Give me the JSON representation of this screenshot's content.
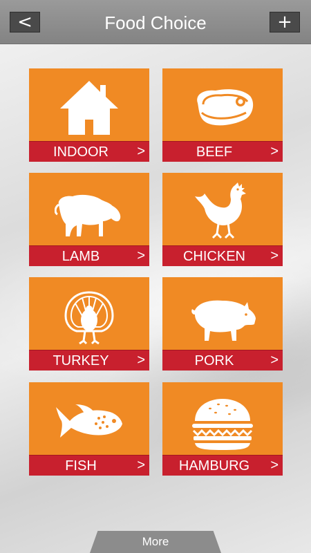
{
  "header": {
    "title": "Food Choice",
    "back_label": "<",
    "add_label": "+"
  },
  "tiles": [
    {
      "label": "INDOOR",
      "arrow": ">",
      "icon": "house-icon"
    },
    {
      "label": "BEEF",
      "arrow": ">",
      "icon": "steak-icon"
    },
    {
      "label": "LAMB",
      "arrow": ">",
      "icon": "lamb-icon"
    },
    {
      "label": "CHICKEN",
      "arrow": ">",
      "icon": "chicken-icon"
    },
    {
      "label": "TURKEY",
      "arrow": ">",
      "icon": "turkey-icon"
    },
    {
      "label": "PORK",
      "arrow": ">",
      "icon": "pig-icon"
    },
    {
      "label": "FISH",
      "arrow": ">",
      "icon": "fish-icon"
    },
    {
      "label": "HAMBURG",
      "arrow": ">",
      "icon": "burger-icon"
    }
  ],
  "footer": {
    "more_label": "More"
  },
  "colors": {
    "tile": "#f08a24",
    "bar": "#c8202e",
    "header": "#8e8e8e"
  }
}
